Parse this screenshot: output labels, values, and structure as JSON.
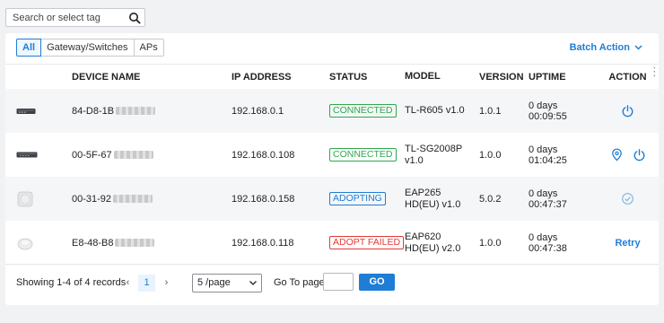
{
  "search": {
    "placeholder": "Search or select tag"
  },
  "tabs": [
    {
      "label": "All",
      "active": true
    },
    {
      "label": "Gateway/Switches",
      "active": false
    },
    {
      "label": "APs",
      "active": false
    }
  ],
  "batch_action": "Batch Action",
  "columns": {
    "name": "DEVICE NAME",
    "ip": "IP ADDRESS",
    "status": "STATUS",
    "model": "MODEL",
    "version": "VERSION",
    "uptime": "UPTIME",
    "action": "ACTION",
    "more": "⋮"
  },
  "devices": [
    {
      "device_type": "gateway",
      "name": "84-D8-1B",
      "ip": "192.168.0.1",
      "status": "CONNECTED",
      "status_color": "#2fa84f",
      "model_l1": "TL-R605 v1.0",
      "model_l2": "",
      "version": "1.0.1",
      "uptime_l1": "0 days",
      "uptime_l2": "00:09:55",
      "actions": [
        "power-icon"
      ]
    },
    {
      "device_type": "switch",
      "name": "00-5F-67",
      "ip": "192.168.0.108",
      "status": "CONNECTED",
      "status_color": "#2fa84f",
      "model_l1": "TL-SG2008P",
      "model_l2": "v1.0",
      "version": "1.0.0",
      "uptime_l1": "0 days",
      "uptime_l2": "01:04:25",
      "actions": [
        "locate-icon",
        "power-icon"
      ]
    },
    {
      "device_type": "access-point",
      "name": "00-31-92",
      "ip": "192.168.0.158",
      "status": "ADOPTING",
      "status_color": "#1f7dd6",
      "model_l1": "EAP265",
      "model_l2": "HD(EU) v1.0",
      "version": "5.0.2",
      "uptime_l1": "0 days",
      "uptime_l2": "00:47:37",
      "actions": [
        "check-circle-icon"
      ]
    },
    {
      "device_type": "access-point",
      "name": "E8-48-B8",
      "ip": "192.168.0.118",
      "status": "ADOPT FAILED",
      "status_color": "#e53935",
      "model_l1": "EAP620",
      "model_l2": "HD(EU) v2.0",
      "version": "1.0.0",
      "uptime_l1": "0 days",
      "uptime_l2": "00:47:38",
      "actions": [
        "retry"
      ],
      "retry_label": "Retry"
    }
  ],
  "pagination": {
    "records": "Showing 1-4 of 4 records",
    "prev": "‹",
    "page": "1",
    "next": "›",
    "per_page": "5 /page",
    "goto_label": "Go To page:",
    "goto_value": "",
    "go": "GO"
  },
  "colors": {
    "accent": "#1f7dd6",
    "connected": "#2fa84f",
    "failed": "#e53935"
  }
}
